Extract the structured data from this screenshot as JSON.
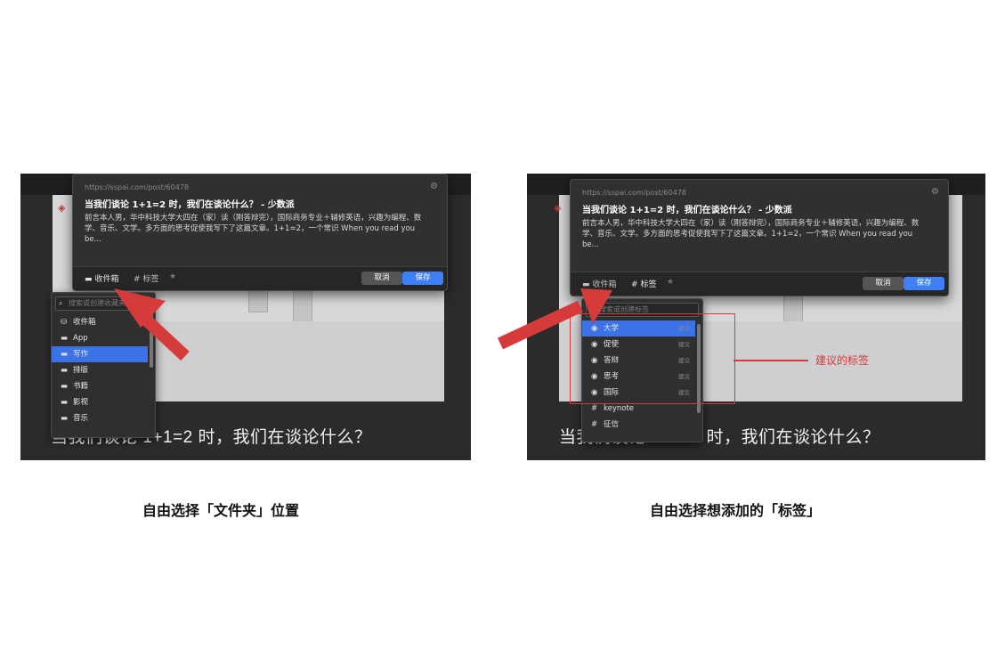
{
  "popup": {
    "url": "https://sspai.com/post/60478",
    "title": "当我们谈论 1+1=2 时，我们在谈论什么？ - 少数派",
    "description": "前言本人男，华中科技大学大四在（家）读（刚答辩完），国际商务专业＋辅修英语，兴趣为编程、数学、音乐、文学。多方面的思考促使我写下了这篇文章。1+1=2，一个常识 When you read you be...",
    "inbox_label": "收件箱",
    "tag_label": "标签",
    "cancel_label": "取消",
    "save_label": "保存"
  },
  "left": {
    "search_placeholder": "搜索或创建收藏夹",
    "folders": [
      {
        "label": "收件箱",
        "icon": "inbox-icon"
      },
      {
        "label": "App",
        "icon": "folder-icon"
      },
      {
        "label": "写作",
        "icon": "folder-icon",
        "selected": true
      },
      {
        "label": "排版",
        "icon": "folder-icon"
      },
      {
        "label": "书籍",
        "icon": "folder-icon"
      },
      {
        "label": "影视",
        "icon": "folder-icon"
      },
      {
        "label": "音乐",
        "icon": "folder-icon"
      }
    ],
    "caption": "自由选择「文件夹」位置"
  },
  "right": {
    "search_placeholder": "搜索或创建标签",
    "tags": [
      {
        "label": "大学",
        "suggested": "建议",
        "selected": true
      },
      {
        "label": "促使",
        "suggested": "建议"
      },
      {
        "label": "答辩",
        "suggested": "建议"
      },
      {
        "label": "思考",
        "suggested": "建议"
      },
      {
        "label": "国际",
        "suggested": "建议"
      },
      {
        "label": "keynote",
        "suggested": ""
      },
      {
        "label": "征信",
        "suggested": ""
      }
    ],
    "annotation": "建议的标签",
    "caption": "自由选择想添加的「标签」"
  },
  "background_heading": "当我们谈论 1+1=2 时，我们在谈论什么？",
  "colors": {
    "accent": "#3f7ff5",
    "annotation": "#d63b3b"
  }
}
